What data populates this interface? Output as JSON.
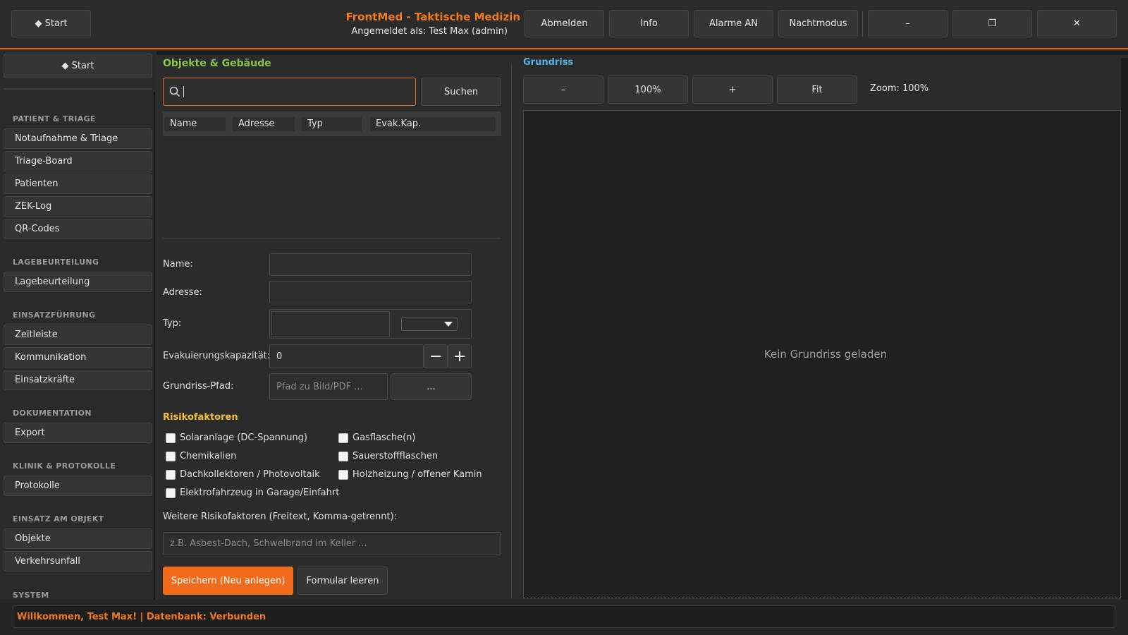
{
  "header": {
    "start_label": "◆ Start",
    "app_title": "FrontMed - Taktische Medizin",
    "user_info": "Angemeldet als: Test Max (admin)",
    "buttons": [
      "Abmelden",
      "Info",
      "Alarme AN",
      "Nachtmodus"
    ],
    "window_controls": {
      "minimize": "–",
      "maximize": "❐",
      "close": "✕"
    }
  },
  "sidebar": {
    "start_label": "◆ Start",
    "sections": [
      {
        "title": "PATIENT & TRIAGE",
        "items": [
          "Notaufnahme & Triage",
          "Triage-Board",
          "Patienten",
          "ZEK-Log",
          "QR-Codes"
        ]
      },
      {
        "title": "LAGEBEURTEILUNG",
        "items": [
          "Lagebeurteilung"
        ]
      },
      {
        "title": "EINSATZFÜHRUNG",
        "items": [
          "Zeitleiste",
          "Kommunikation",
          "Einsatzkräfte"
        ]
      },
      {
        "title": "DOKUMENTATION",
        "items": [
          "Export"
        ]
      },
      {
        "title": "KLINIK & PROTOKOLLE",
        "items": [
          "Protokolle"
        ]
      },
      {
        "title": "EINSATZ AM OBJEKT",
        "items": [
          "Objekte",
          "Verkehrsunfall"
        ]
      },
      {
        "title": "SYSTEM",
        "items": []
      }
    ]
  },
  "objects": {
    "title": "Objekte & Gebäude",
    "search_button": "Suchen",
    "columns": [
      "Name",
      "Adresse",
      "Typ",
      "Evak.Kap."
    ],
    "form": {
      "name_label": "Name:",
      "address_label": "Adresse:",
      "type_label": "Typ:",
      "capacity_label": "Evakuierungskapazität:",
      "capacity_value": "0",
      "path_label": "Grundriss-Pfad:",
      "path_placeholder": "Pfad zu Bild/PDF ...",
      "browse_label": "..."
    },
    "risk_title": "Risikofaktoren",
    "risks_left": [
      "Solaranlage (DC-Spannung)",
      "Chemikalien",
      "Dachkollektoren / Photovoltaik",
      "Elektrofahrzeug in Garage/Einfahrt"
    ],
    "risks_right": [
      "Gasflasche(n)",
      "Sauerstoffflaschen",
      "Holzheizung / offener Kamin"
    ],
    "further_label": "Weitere Risikofaktoren (Freitext, Komma-getrennt):",
    "further_placeholder": "z.B. Asbest-Dach, Schwelbrand im Keller ...",
    "save_button": "Speichern (Neu anlegen)",
    "clear_button": "Formular leeren"
  },
  "floorplan": {
    "title": "Grundriss",
    "zoom_out": "–",
    "zoom_reset": "100%",
    "zoom_in": "+",
    "fit": "Fit",
    "zoom_label": "Zoom: 100%",
    "empty_text": "Kein Grundriss geladen"
  },
  "status": {
    "text": "Willkommen, Test Max! | Datenbank: Verbunden"
  },
  "colors": {
    "accent": "#f26b1d",
    "green": "#8bc34a",
    "blue": "#4fb3e6",
    "yellow": "#f2c232"
  }
}
